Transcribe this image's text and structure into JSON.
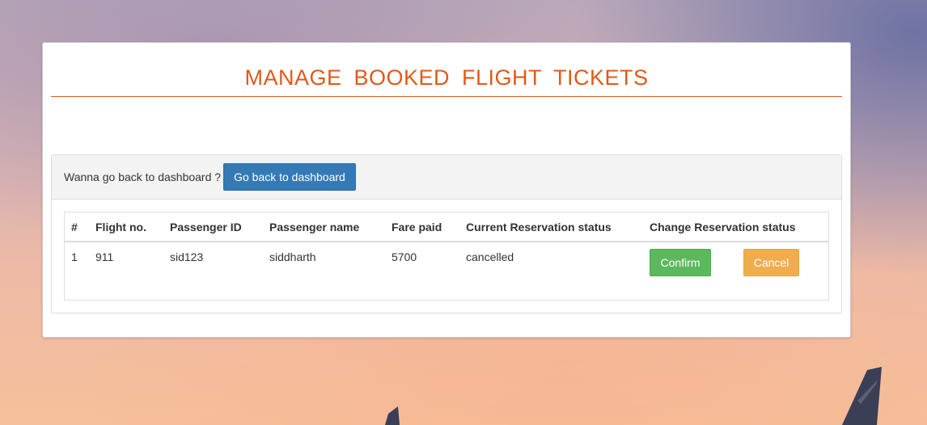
{
  "header": {
    "title": "MANAGE BOOKED FLIGHT TICKETS"
  },
  "back_prompt": {
    "text": "Wanna go back to dashboard ?",
    "button_label": "Go back to dashboard"
  },
  "table": {
    "columns": [
      "#",
      "Flight no.",
      "Passenger ID",
      "Passenger name",
      "Fare paid",
      "Current Reservation status",
      "Change Reservation status"
    ],
    "rows": [
      {
        "index": "1",
        "flight_no": "911",
        "passenger_id": "sid123",
        "passenger_name": "siddharth",
        "fare_paid": "5700",
        "status": "cancelled",
        "confirm_label": "Confirm",
        "cancel_label": "Cancel"
      }
    ]
  },
  "colors": {
    "title": "#e05a1a",
    "primary_button": "#337ab7",
    "success_button": "#5cb85c",
    "warning_button": "#f0ad4e"
  },
  "icons": {
    "background": "airplane-tail-silhouette-icon"
  }
}
